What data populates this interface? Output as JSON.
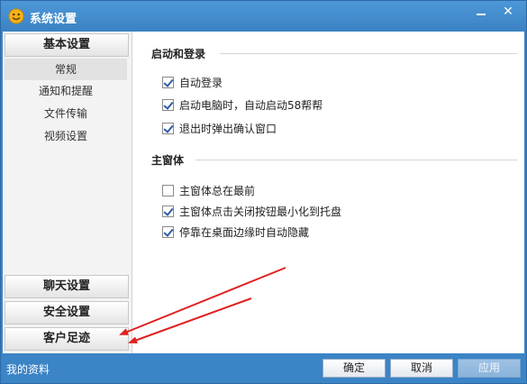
{
  "window": {
    "title": "系统设置",
    "close_glyph": "✕"
  },
  "sidebar": {
    "basic_settings": "基本设置",
    "sub_items": [
      "常规",
      "通知和提醒",
      "文件传输",
      "视频设置"
    ],
    "chat_settings": "聊天设置",
    "security_settings": "安全设置",
    "customer_footprint": "客户足迹"
  },
  "content": {
    "startup": {
      "title": "启动和登录",
      "options": [
        {
          "label": "自动登录",
          "checked": true
        },
        {
          "label": "启动电脑时，自动启动58帮帮",
          "checked": true
        },
        {
          "label": "退出时弹出确认窗口",
          "checked": true
        }
      ]
    },
    "main_window": {
      "title": "主窗体",
      "options": [
        {
          "label": "主窗体总在最前",
          "checked": false
        },
        {
          "label": "主窗体点击关闭按钮最小化到托盘",
          "checked": true
        },
        {
          "label": "停靠在桌面边缘时自动隐藏",
          "checked": true
        }
      ]
    }
  },
  "footer": {
    "my_info": "我的资料",
    "ok": "确定",
    "cancel": "取消",
    "apply": "应用"
  },
  "colors": {
    "accent": "#3b84c6",
    "arrow": "#e02020"
  },
  "icons": {
    "app": "smiley-face-icon",
    "close": "close-icon",
    "minimize": "minimize-icon",
    "check": "checkmark-icon"
  }
}
